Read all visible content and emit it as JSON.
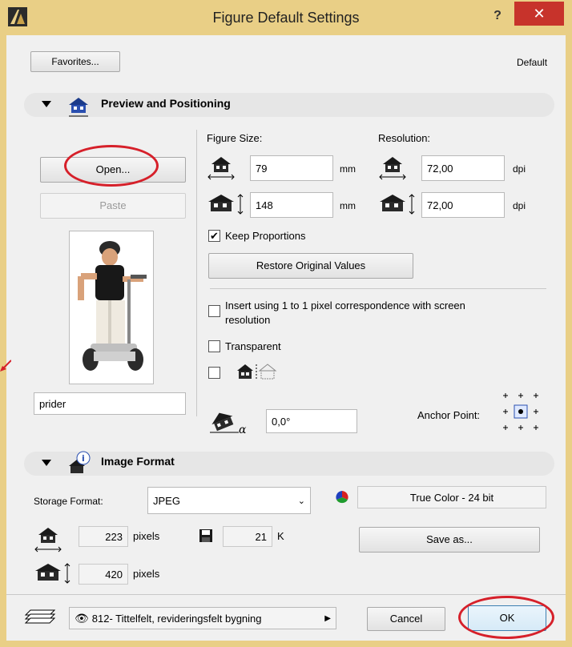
{
  "window": {
    "title": "Figure Default Settings",
    "help": "?",
    "close": "✕"
  },
  "top": {
    "favorites_label": "Favorites...",
    "default_label": "Default"
  },
  "preview_section": {
    "title": "Preview and Positioning",
    "open_label": "Open...",
    "paste_label": "Paste",
    "figure_name": "prider",
    "figure_size_label": "Figure Size:",
    "resolution_label": "Resolution:",
    "width_value": "79",
    "height_value": "148",
    "size_unit": "mm",
    "res_x_value": "72,00",
    "res_y_value": "72,00",
    "res_unit": "dpi",
    "keep_proportions_label": "Keep Proportions",
    "keep_proportions_checked": true,
    "restore_label": "Restore Original Values",
    "insert_label_line1": "Insert using 1 to 1 pixel correspondence with screen",
    "insert_label_line2": "resolution",
    "transparent_label": "Transparent",
    "angle_value": "0,0°",
    "anchor_label": "Anchor Point:"
  },
  "image_format_section": {
    "title": "Image Format",
    "storage_format_label": "Storage Format:",
    "storage_format_value": "JPEG",
    "color_depth_value": "True Color - 24 bit",
    "pixels_w": "223",
    "pixels_h": "420",
    "pixels_unit": "pixels",
    "file_size": "21",
    "file_size_unit": "K",
    "save_as_label": "Save as..."
  },
  "bottom": {
    "layer_value": "812- Tittelfelt, revideringsfelt bygning",
    "cancel_label": "Cancel",
    "ok_label": "OK"
  },
  "colors": {
    "title_bar": "#e9cf86",
    "close_button": "#c7332b",
    "annotation_red": "#d6202a"
  }
}
